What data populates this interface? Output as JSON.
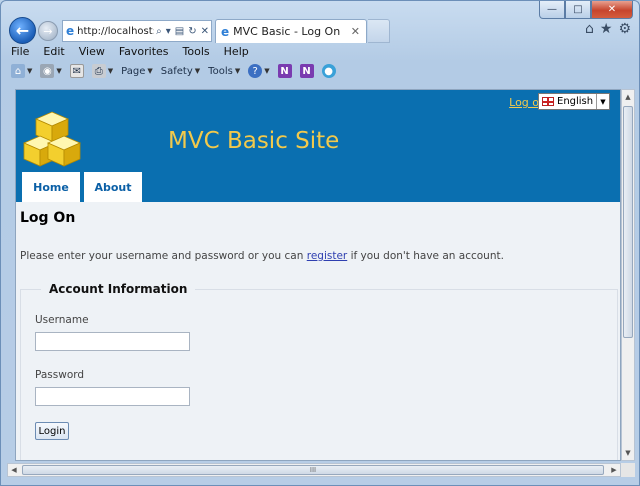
{
  "browser": {
    "address_url": "http://localhost:",
    "tab_title": "MVC Basic - Log On",
    "menu": [
      "File",
      "Edit",
      "View",
      "Favorites",
      "Tools",
      "Help"
    ],
    "commands": [
      "Page",
      "Safety",
      "Tools"
    ],
    "scrollbar_grip": "III"
  },
  "header": {
    "login_link": "Log on",
    "language": "English",
    "site_title": "MVC Basic Site",
    "nav": [
      "Home",
      "About"
    ]
  },
  "page": {
    "title": "Log On",
    "intro_before": "Please enter your username and password or you can ",
    "intro_link": "register",
    "intro_after": " if you don't have an account.",
    "fieldset_legend": "Account Information",
    "username_label": "Username",
    "username_value": "",
    "password_label": "Password",
    "password_value": "",
    "login_button": "Login"
  },
  "colors": {
    "header_bg": "#0a6fb0",
    "accent_gold": "#f2c94c",
    "link_blue": "#2e3fb0"
  }
}
